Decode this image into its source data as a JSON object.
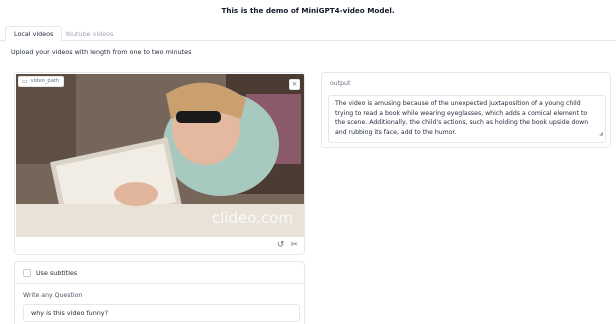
{
  "header": {
    "title": "This is the demo of MiniGPT4-video Model."
  },
  "tabs": [
    {
      "label": "Local videos",
      "active": true
    },
    {
      "label": "Youtube videos",
      "active": false
    }
  ],
  "instruction": "Upload your videos with length from one to two minutes",
  "video": {
    "label": "video_path",
    "watermark": "clideo.com",
    "close_icon": "close-icon",
    "controls": [
      "undo-icon",
      "scissors-icon"
    ]
  },
  "options": {
    "subtitles_label": "Use subtitles",
    "subtitles_checked": false,
    "question_label": "Write any Question",
    "question_value": "why is this video funny?"
  },
  "output": {
    "label": "output",
    "text": "The video is amusing because of the unexpected juxtaposition of a young child trying to read a book while wearing eyeglasses, which adds a comical element to the scene. Additionally, the child's actions, such as holding the book upside down and rubbing its face, add to the humor."
  }
}
